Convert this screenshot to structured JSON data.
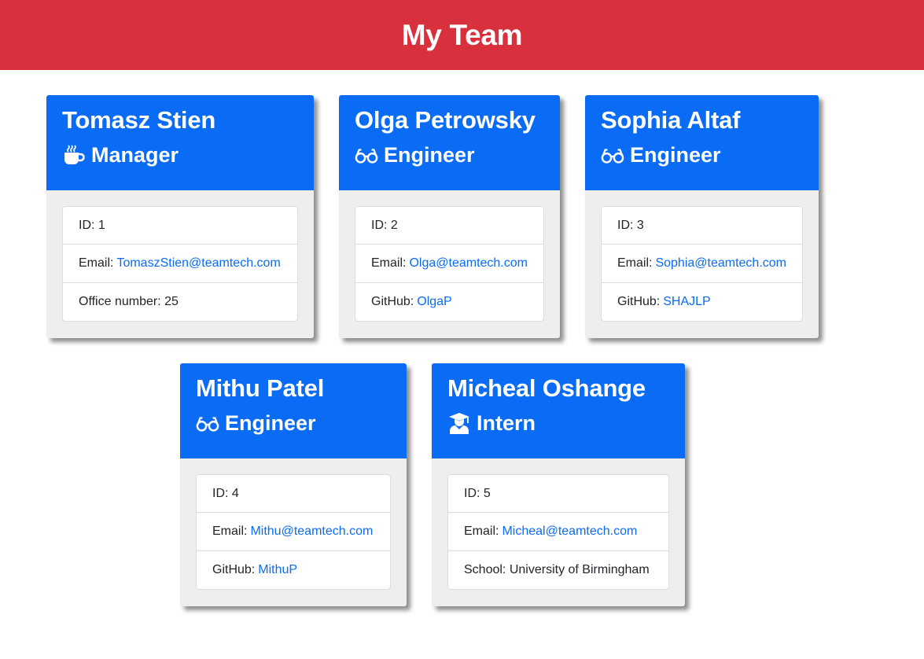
{
  "header": {
    "title": "My Team"
  },
  "colors": {
    "header_bg": "#d9303e",
    "card_head_bg": "#0a6cf5",
    "link": "#0a6cf5"
  },
  "employees": [
    {
      "name": "Tomasz Stien",
      "role": "Manager",
      "icon": "coffee-icon",
      "id_label": "ID:",
      "id": "1",
      "email_label": "Email:",
      "email": "TomaszStien@teamtech.com",
      "extra_label": "Office number:",
      "extra": "25"
    },
    {
      "name": "Olga Petrowsky",
      "role": "Engineer",
      "icon": "glasses-icon",
      "id_label": "ID:",
      "id": "2",
      "email_label": "Email:",
      "email": "Olga@teamtech.com",
      "extra_label": "GitHub:",
      "extra": "OlgaP"
    },
    {
      "name": "Sophia Altaf",
      "role": "Engineer",
      "icon": "glasses-icon",
      "id_label": "ID:",
      "id": "3",
      "email_label": "Email:",
      "email": "Sophia@teamtech.com",
      "extra_label": "GitHub:",
      "extra": "SHAJLP"
    },
    {
      "name": "Mithu Patel",
      "role": "Engineer",
      "icon": "glasses-icon",
      "id_label": "ID:",
      "id": "4",
      "email_label": "Email:",
      "email": "Mithu@teamtech.com",
      "extra_label": "GitHub:",
      "extra": "MithuP"
    },
    {
      "name": "Micheal Oshange",
      "role": "Intern",
      "icon": "graduate-icon",
      "id_label": "ID:",
      "id": "5",
      "email_label": "Email:",
      "email": "Micheal@teamtech.com",
      "extra_label": "School:",
      "extra": "University of Birmingham"
    }
  ]
}
